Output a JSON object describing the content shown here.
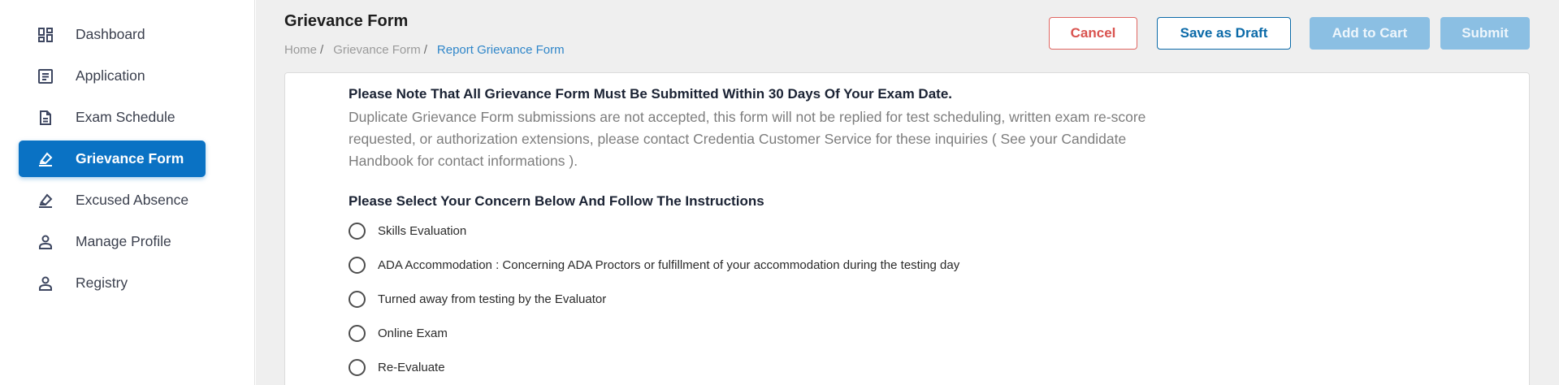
{
  "sidebar": {
    "items": [
      {
        "label": "Dashboard",
        "icon": "dashboard-icon",
        "active": false
      },
      {
        "label": "Application",
        "icon": "application-icon",
        "active": false
      },
      {
        "label": "Exam Schedule",
        "icon": "document-icon",
        "active": false
      },
      {
        "label": "Grievance Form",
        "icon": "eraser-icon",
        "active": true
      },
      {
        "label": "Excused Absence",
        "icon": "eraser-icon",
        "active": false
      },
      {
        "label": "Manage Profile",
        "icon": "user-icon",
        "active": false
      },
      {
        "label": "Registry",
        "icon": "user-icon",
        "active": false
      }
    ]
  },
  "header": {
    "title": "Grievance Form",
    "breadcrumb": [
      "Home",
      "Grievance Form",
      "Report Grievance Form"
    ],
    "breadcrumb_sep": "/"
  },
  "actions": {
    "cancel": "Cancel",
    "save_draft": "Save as Draft",
    "add_to_cart": "Add to Cart",
    "submit": "Submit"
  },
  "form": {
    "note_heading": "Please Note That All Grievance Form Must Be Submitted Within 30 Days Of Your Exam Date.",
    "note_body": "Duplicate Grievance Form submissions are not accepted, this form will not be replied for test scheduling, written exam re-score requested, or authorization extensions, please contact Credentia Customer Service for these inquiries ( See your Candidate Handbook for contact informations ).",
    "concern_heading": "Please Select Your Concern Below And Follow The Instructions",
    "options": [
      "Skills Evaluation",
      "ADA Accommodation : Concerning ADA Proctors or fulfillment of your accommodation during the testing day",
      "Turned away from testing by the Evaluator",
      "Online Exam",
      "Re-Evaluate"
    ]
  },
  "colors": {
    "primary": "#0a72c4",
    "cancel": "#d9534f",
    "disabled": "#8bbfe3",
    "breadcrumb_active": "#2f86c9"
  }
}
